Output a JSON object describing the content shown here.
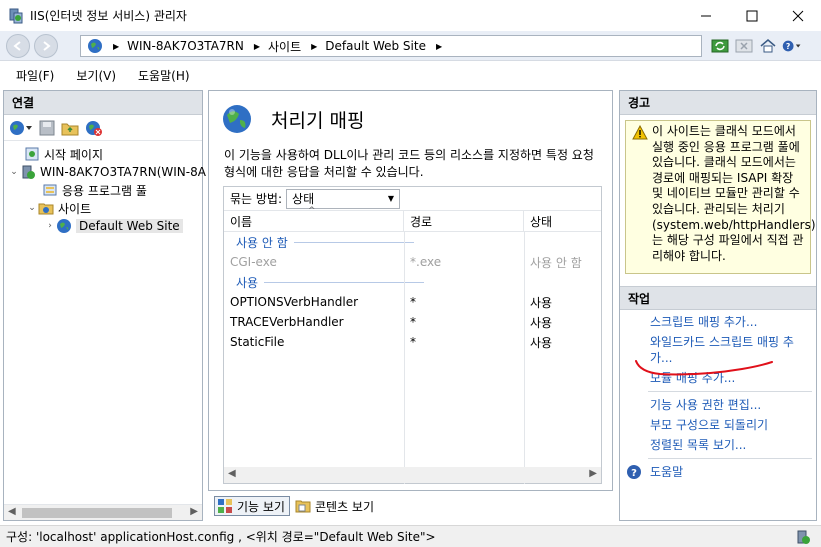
{
  "window": {
    "title": "IIS(인터넷 정보 서비스) 관리자",
    "min_icon": "minimize-icon",
    "max_icon": "maximize-icon",
    "close_icon": "close-icon"
  },
  "address": {
    "crumbs": [
      "WIN-8AK7O3TA7RN",
      "사이트",
      "Default Web Site"
    ]
  },
  "menu": {
    "items": [
      "파일(F)",
      "보기(V)",
      "도움말(H)"
    ]
  },
  "connections": {
    "title": "연결",
    "tree": [
      {
        "label": "시작 페이지"
      },
      {
        "label": "WIN-8AK7O3TA7RN(WIN-8A"
      },
      {
        "label": "응용 프로그램 풀"
      },
      {
        "label": "사이트"
      },
      {
        "label": "Default Web Site"
      }
    ]
  },
  "feature": {
    "title": "처리기 매핑",
    "description": "이 기능을 사용하여 DLL이나 관리 코드 등의 리소스를 지정하면 특정 요청 형식에 대한 응답을 처리할 수 있습니다.",
    "group_by_label": "묶는 방법:",
    "group_by_value": "상태",
    "columns": [
      "이름",
      "경로",
      "상태"
    ],
    "groups": [
      {
        "label": "사용 안 함",
        "rows": [
          {
            "name": "CGI-exe",
            "path": "*.exe",
            "state": "사용 안 함"
          }
        ]
      },
      {
        "label": "사용",
        "rows": [
          {
            "name": "OPTIONSVerbHandler",
            "path": "*",
            "state": "사용"
          },
          {
            "name": "TRACEVerbHandler",
            "path": "*",
            "state": "사용"
          },
          {
            "name": "StaticFile",
            "path": "*",
            "state": "사용"
          }
        ]
      }
    ]
  },
  "view_tabs": {
    "features": "기능 보기",
    "content": "콘텐츠 보기"
  },
  "alerts": {
    "title": "경고",
    "message": "이 사이트는 클래식 모드에서 실행 중인 응용 프로그램 풀에 있습니다. 클래식 모드에서는 경로에 매핑되는 ISAPI 확장 및 네이티브 모듈만 관리할 수 있습니다. 관리되는 처리기(system.web/httpHandlers)는 해당 구성 파일에서 직접 관리해야 합니다."
  },
  "actions": {
    "title": "작업",
    "group1": [
      "스크립트 매핑 추가...",
      "와일드카드 스크립트 매핑 추가...",
      "모듈 매핑 추가..."
    ],
    "group2": [
      "기능 사용 권한 편집...",
      "부모 구성으로 되돌리기",
      "정렬된 목록 보기..."
    ],
    "help": "도움말"
  },
  "status": {
    "text": "구성: 'localhost' applicationHost.config , <위치 경로=\"Default Web Site\">"
  },
  "colors": {
    "link": "#1e5bb7",
    "annotation": "#e0101a",
    "panel_header": "#dfe3e8",
    "alert_bg": "#ffffe1"
  }
}
